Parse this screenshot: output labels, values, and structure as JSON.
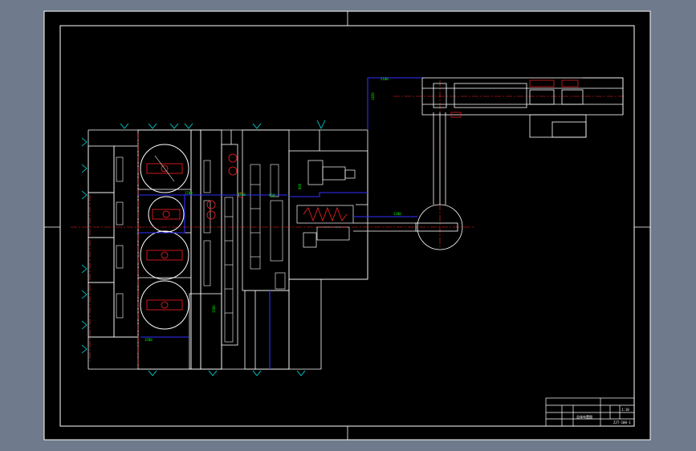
{
  "window": {
    "background": "#6f7a8c",
    "canvas_background": "#000000"
  },
  "colors": {
    "outline": "#ffffff",
    "centerline": "#ff2020",
    "dimension": "#00ff00",
    "flow": "#3030ff",
    "marker": "#00e5e5"
  },
  "title_block": {
    "drawing_name": "总体布置图",
    "drawing_number": "ZJT-100-1",
    "scale": "1:10"
  },
  "dimensions": {
    "labels": [
      "2100",
      "1450",
      "1700",
      "800",
      "950",
      "1200",
      "1580",
      "1580",
      "2450"
    ]
  }
}
